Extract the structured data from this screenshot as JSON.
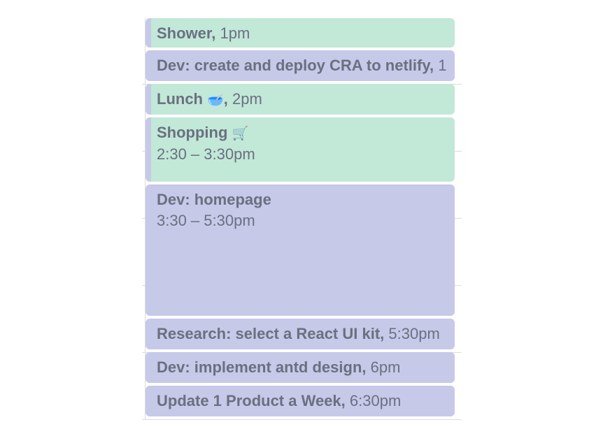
{
  "events": [
    {
      "title": "Shower",
      "time": "1pm",
      "color": "#c2e8d8"
    },
    {
      "title": "Dev: create and deploy CRA to netlify",
      "time": "1",
      "color": "#c6c9e8"
    },
    {
      "title": "Lunch",
      "emoji": "🥣",
      "time": "2pm",
      "color": "#c2e8d8"
    },
    {
      "title": "Shopping",
      "emoji": "🛒",
      "time": "2:30 – 3:30pm",
      "color": "#c2e8d8"
    },
    {
      "title": "Dev: homepage",
      "time": "3:30 – 5:30pm",
      "color": "#c6c9e8"
    },
    {
      "title": "Research: select a React UI kit",
      "time": "5:30pm",
      "color": "#c6c9e8"
    },
    {
      "title": "Dev: implement antd design",
      "time": "6pm",
      "color": "#c6c9e8"
    },
    {
      "title": "Update 1 Product a Week",
      "time": "6:30pm",
      "color": "#c6c9e8"
    }
  ],
  "separator": ","
}
